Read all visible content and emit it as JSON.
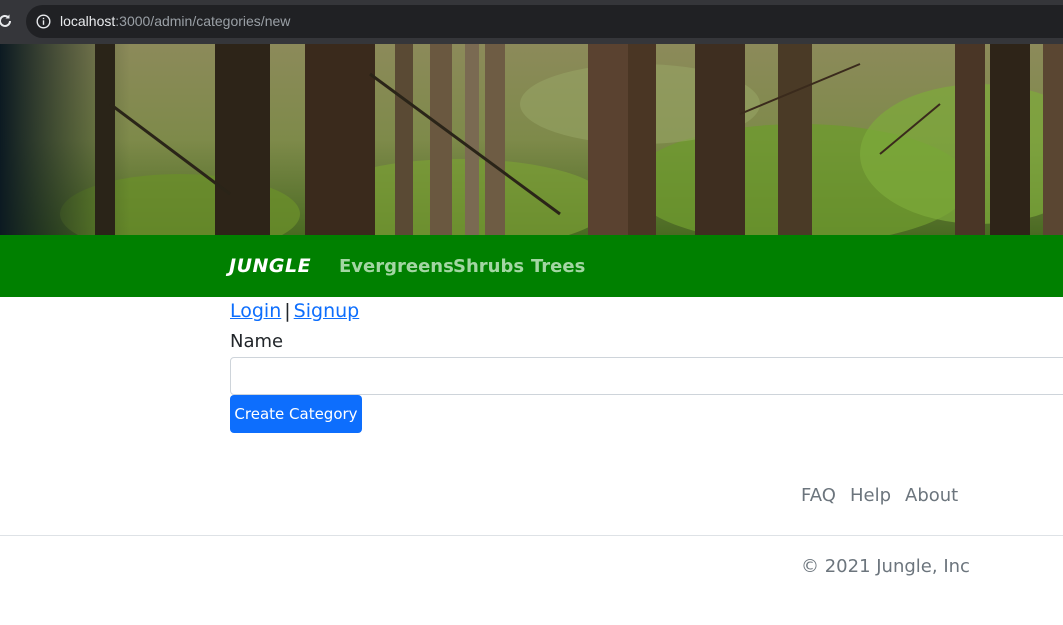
{
  "browser": {
    "url_host": "localhost",
    "url_path": ":3000/admin/categories/new"
  },
  "nav": {
    "brand": "JUNGLE",
    "links": [
      "Evergreens",
      "Shrubs",
      "Trees"
    ],
    "bg_color": "#008000"
  },
  "auth": {
    "login": "Login",
    "separator": "|",
    "signup": "Signup"
  },
  "form": {
    "name_label": "Name",
    "name_value": "",
    "submit_label": "Create Category",
    "button_color": "#0d6efd"
  },
  "footer": {
    "links": [
      "FAQ",
      "Help",
      "About"
    ],
    "copyright": "© 2021 Jungle, Inc"
  }
}
